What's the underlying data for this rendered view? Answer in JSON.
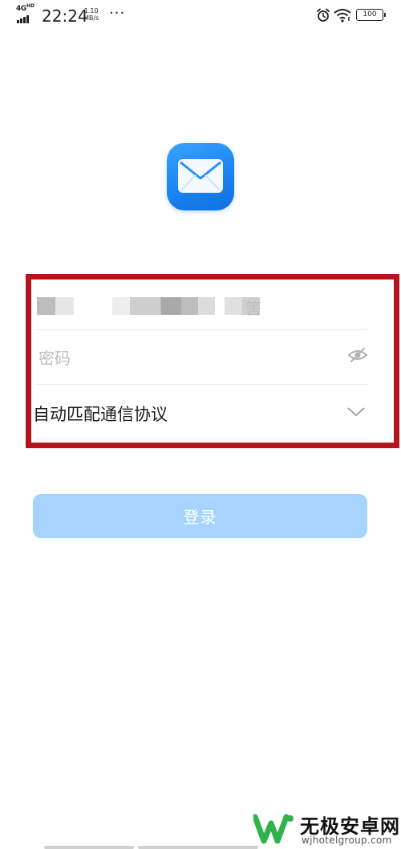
{
  "status_bar": {
    "network": "4G",
    "network_sup": "HD",
    "time": "22:24",
    "speed_value": "1.10",
    "speed_unit": "MB/s",
    "more": "···",
    "battery": "100",
    "icons": [
      "alarm-icon",
      "wifi-icon",
      "battery-icon"
    ]
  },
  "app": {
    "logo_icon": "mail-icon",
    "accent_color": "#1a85f0"
  },
  "form": {
    "account_value_visible": "筈",
    "password_placeholder": "密码",
    "password_toggle_icon": "eye-off-icon",
    "protocol_label": "自动匹配通信协议",
    "protocol_icon": "chevron-down-icon",
    "highlight_color": "#b5141c"
  },
  "login_button": {
    "label": "登录",
    "color": "#a6d4ff"
  },
  "watermark": {
    "title": "无极安卓网",
    "subtitle": "wjhotelgroup.com"
  }
}
